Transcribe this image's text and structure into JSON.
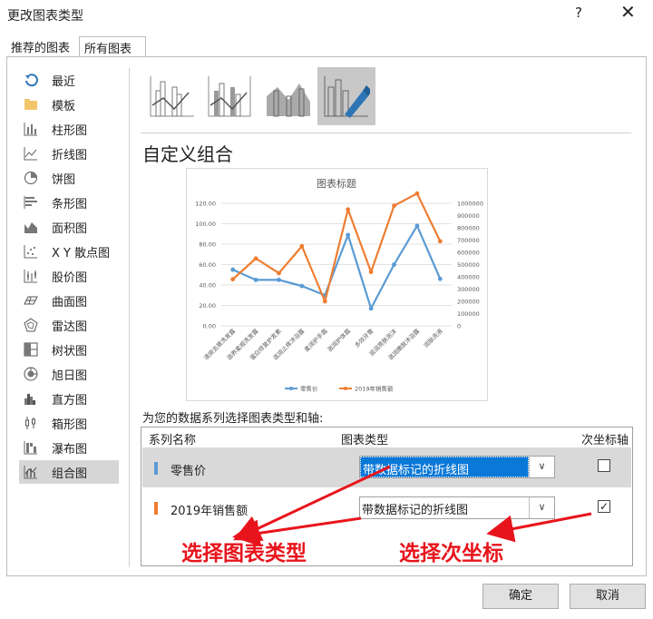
{
  "window": {
    "title": "更改图表类型",
    "help_label": "?",
    "close_label": "✕"
  },
  "tabs": [
    {
      "label": "推荐的图表"
    },
    {
      "label": "所有图表"
    }
  ],
  "sidebar": {
    "items": [
      {
        "label": "最近",
        "icon": "recent-icon"
      },
      {
        "label": "模板",
        "icon": "folder-icon"
      },
      {
        "label": "柱形图",
        "icon": "column-chart-icon"
      },
      {
        "label": "折线图",
        "icon": "line-chart-icon"
      },
      {
        "label": "饼图",
        "icon": "pie-chart-icon"
      },
      {
        "label": "条形图",
        "icon": "bar-chart-icon"
      },
      {
        "label": "面积图",
        "icon": "area-chart-icon"
      },
      {
        "label": "X Y 散点图",
        "icon": "scatter-chart-icon"
      },
      {
        "label": "股价图",
        "icon": "stock-chart-icon"
      },
      {
        "label": "曲面图",
        "icon": "surface-chart-icon"
      },
      {
        "label": "雷达图",
        "icon": "radar-chart-icon"
      },
      {
        "label": "树状图",
        "icon": "treemap-chart-icon"
      },
      {
        "label": "旭日图",
        "icon": "sunburst-chart-icon"
      },
      {
        "label": "直方图",
        "icon": "histogram-chart-icon"
      },
      {
        "label": "箱形图",
        "icon": "box-chart-icon"
      },
      {
        "label": "瀑布图",
        "icon": "waterfall-chart-icon"
      },
      {
        "label": "组合图",
        "icon": "combo-chart-icon"
      }
    ],
    "selected_index": 16
  },
  "subtypes": {
    "selected_index": 3
  },
  "section_heading": "自定义组合",
  "chart_data": {
    "type": "line",
    "title": "图表标题",
    "categories": [
      "清爽去屑洗发露",
      "滋养柔顺洗发露",
      "蛋白修复护发素",
      "滋润止痒沐浴露",
      "柔润护手霜",
      "滋润护体霜",
      "多效牙膏",
      "滋润亮肤泡沫",
      "滋润嫩肤沐浴露",
      "润肤洗液"
    ],
    "y_left": {
      "ticks": [
        "0.00",
        "20.00",
        "40.00",
        "60.00",
        "80.00",
        "100.00",
        "120.00"
      ],
      "range": [
        0,
        120
      ]
    },
    "y_right": {
      "ticks": [
        "0",
        "100000",
        "200000",
        "300000",
        "400000",
        "500000",
        "600000",
        "700000",
        "800000",
        "900000",
        "1000000"
      ],
      "range": [
        0,
        1000000
      ]
    },
    "series": [
      {
        "name": "零售价",
        "axis": "left",
        "color": "#5b9bd5",
        "values": [
          55,
          45,
          45,
          39,
          30,
          89,
          17,
          60,
          98,
          46
        ]
      },
      {
        "name": "2019年销售额",
        "axis": "right",
        "color": "#ed7d31",
        "values": [
          380000,
          550000,
          430000,
          650000,
          200000,
          950000,
          440000,
          980000,
          1080000,
          690000
        ]
      }
    ],
    "legend": "bottom",
    "grid": true
  },
  "series_prompt": "为您的数据系列选择图表类型和轴:",
  "grid_headers": {
    "name": "系列名称",
    "type": "图表类型",
    "secondary": "次坐标轴"
  },
  "series_rows": [
    {
      "name": "零售价",
      "color": "#5b9bd5",
      "chart_type": "带数据标记的折线图",
      "secondary_axis": false
    },
    {
      "name": "2019年销售额",
      "color": "#ed7d31",
      "chart_type": "带数据标记的折线图",
      "secondary_axis": true
    }
  ],
  "annotations": {
    "left": "选择图表类型",
    "right": "选择次坐标"
  },
  "buttons": {
    "ok": "确定",
    "cancel": "取消"
  }
}
